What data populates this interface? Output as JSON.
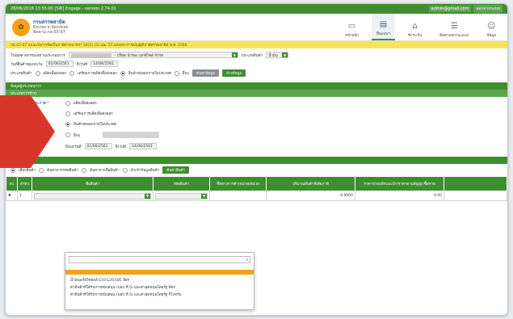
{
  "titlebar": {
    "text": "28/06/2018 13:55:00   [SW] Engage - version 2.74.01",
    "user": "admin@gmail.com",
    "logout": "ออกจากระบบ"
  },
  "brand": {
    "line1": "กรมสรรพสามิต",
    "line2": "Excise e-Services",
    "line3": "ติดตาม ภส.03-07"
  },
  "nav": [
    {
      "label": "หน้าหลัก",
      "icon": "monitor-icon"
    },
    {
      "label": "ยื่นแบบฯ",
      "icon": "form-icon"
    },
    {
      "label": "ชำระเงิน",
      "icon": "building-icon"
    },
    {
      "label": "ติดตามสถานะแบบ",
      "icon": "list-icon"
    },
    {
      "label": "ข้อมูล",
      "icon": "people-icon"
    }
  ],
  "breadcrumb": "ภส.03-07 แบบแจ้งการจัดเก็บภาษีตามมาตรา 54(1) (3) และ 55 แห่งพระราชบัญญัติภาษีสรรพสามิต พ.ศ. 2560",
  "top_form": {
    "company_label": "โรงอุตสาหกรรม/สถานประกอบการ",
    "company_value": "- บริษัท นำร่อง เอกซ์ไซส์ จำกัด",
    "branch_label": "ประเภทสินค้า",
    "branch_value": "น้ำมัน",
    "date_label": "วันที่ยื่นคำขอ/ยกเว้น",
    "date_from": "01/06/2561",
    "date_to_label": "ถึงวันที่",
    "date_to": "14/06/2561",
    "type_label": "ประเภทสินค้า",
    "radio_options": [
      "ผลิตเพื่อส่งออก",
      "เตรียมการผลิตเพื่อส่งออก",
      "สินค้าส่งออกภายในประเทศ",
      "อื่นๆ"
    ],
    "btn_search": "ค้นหาข้อมูล",
    "btn_clear": "ล้างข้อมูล"
  },
  "section_main": "ข้อมูลผู้ประกอบการ",
  "section_sub": "ประเภทการชำระ",
  "method": {
    "label": "วิธีการชำระภาษี *",
    "options": [
      "ผลิตเพื่อส่งออก",
      "เตรียมการผลิตเพื่อส่งออก",
      "สินค้าส่งออกภายในประเทศ",
      "อื่นๆ"
    ],
    "date_from_label": "ตั้งแต่วันที่",
    "date_from": "01/06/2561",
    "date_to_label": "ถึงวันที่",
    "date_to": "14/06/2561"
  },
  "goods_section": "รายการสินค้า",
  "goods_toolbar": {
    "opt1": "เลือกสินค้า",
    "opt2": "ค้นหาจากรหัสสินค้า",
    "opt3": "ค้นหาจากชื่อสินค้า",
    "opt4": "นำเข้าข้อมูลสินค้า",
    "btn": "ค้นหาสินค้า"
  },
  "table": {
    "headers": [
      "ลบ",
      "ลำดับ",
      "ชื่อสินค้า",
      "รหัสสินค้า",
      "ชื่อทางการค้า/ขนาด/หน่วย",
      "ปริมาณสินค้าที่เสียภาษี",
      "ราคาขายปลีกแนะนำ/ราคาตามสัญญาซื้อขาย",
      ""
    ],
    "row": {
      "no": "1",
      "qty": "0.0000",
      "price": "0.00"
    }
  },
  "dropdown": {
    "items": [
      "น้ำมันแก๊สโซฮอล์ E10 E20 E85 ลิตร",
      "ค่าสินค้าที่ได้รับการสนับสนุน (มอก.ที่ 5) และค่าอุดหนุนโดยรัฐ ลิตร",
      "ค่าสินค้าที่ได้รับการสนับสนุน (มอก.ที่ 5) และค่าอุดหนุนโดยรัฐ กิโลกรัม"
    ]
  },
  "colors": {
    "brand_green": "#3e8e2f",
    "accent_orange": "#f0a21a",
    "banner_yellow": "#f6e45a",
    "arrow_red": "#d9362b"
  }
}
